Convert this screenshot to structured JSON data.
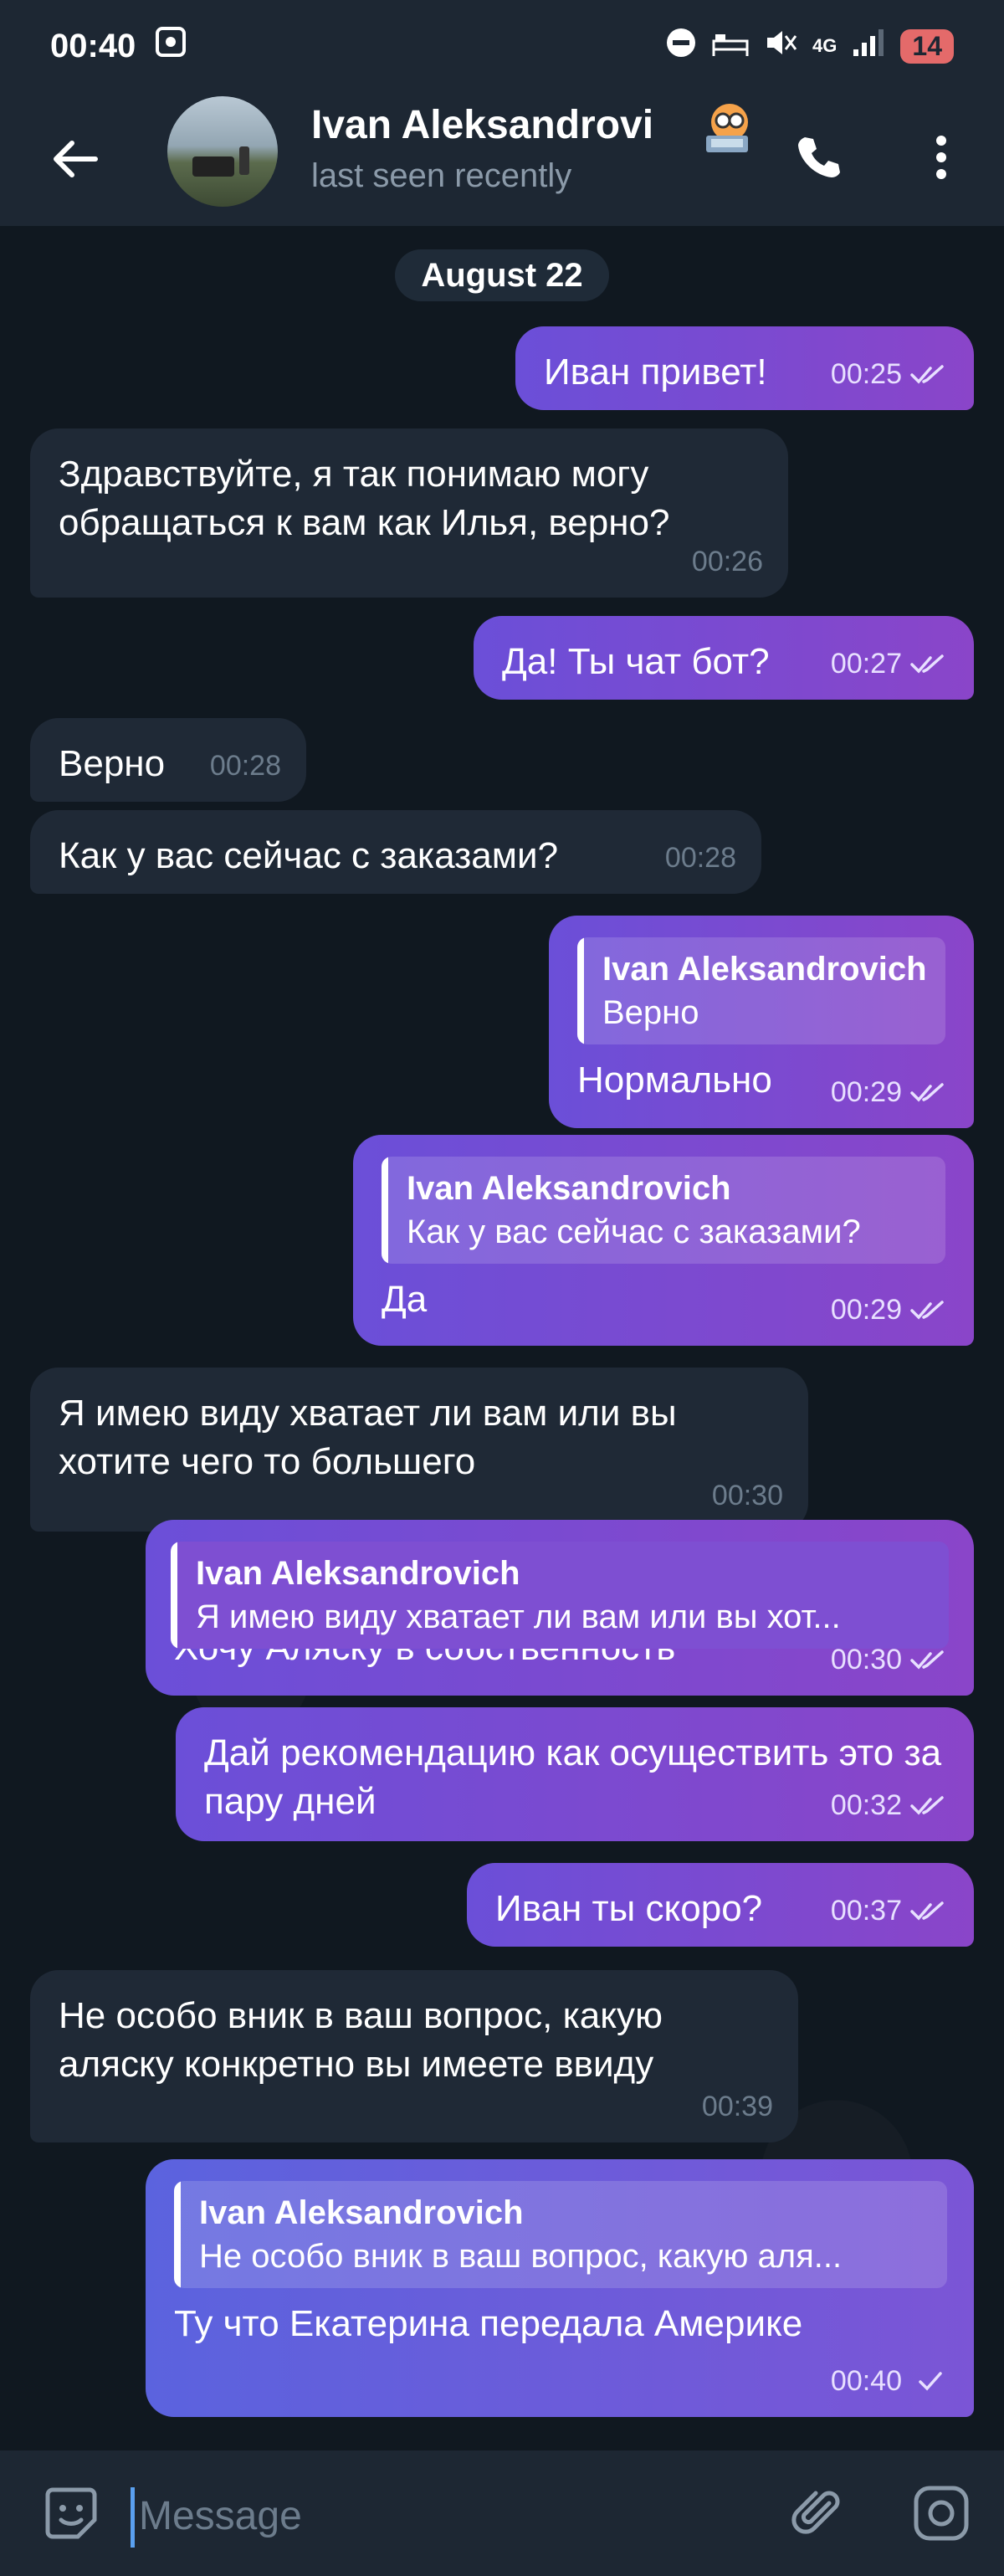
{
  "status_bar": {
    "time": "00:40",
    "network": "4G",
    "battery": "14"
  },
  "header": {
    "name": "Ivan Aleksandrovi",
    "status": "last seen recently"
  },
  "date_label": "August 22",
  "messages": [
    {
      "text": "Иван привет!",
      "time": "00:25"
    },
    {
      "text": "Здравствуйте, я так понимаю могу обращаться к вам как Илья, верно?",
      "time": "00:26"
    },
    {
      "text": "Да! Ты чат бот?",
      "time": "00:27"
    },
    {
      "text": "Верно",
      "time": "00:28"
    },
    {
      "text": "Как у вас сейчас с заказами?",
      "time": "00:28"
    },
    {
      "reply_name": "Ivan Aleksandrovich",
      "reply_text": "Верно",
      "text": "Нормально",
      "time": "00:29"
    },
    {
      "reply_name": "Ivan Aleksandrovich",
      "reply_text": "Как у вас сейчас с заказами?",
      "text": "Да",
      "time": "00:29"
    },
    {
      "text": "Я имею виду хватает ли вам или вы хотите чего то большего",
      "time": "00:30"
    },
    {
      "reply_name": "Ivan Aleksandrovich",
      "reply_text": "Я имею виду хватает ли вам или вы хот...",
      "text": "Хочу Аляску в собственность",
      "time": "00:30"
    },
    {
      "text": "Дай рекомендацию как осуществить это за пару дней",
      "time": "00:32"
    },
    {
      "text": "Иван ты скоро?",
      "time": "00:37"
    },
    {
      "text": "Не особо вник в ваш вопрос, какую аляску конкретно вы имеете ввиду",
      "time": "00:39"
    },
    {
      "reply_name": "Ivan Aleksandrovich",
      "reply_text": "Не особо вник в ваш вопрос, какую аля...",
      "text": "Ту что Екатерина передала Америке",
      "time": "00:40"
    }
  ],
  "input": {
    "placeholder": "Message"
  },
  "colors": {
    "outgoing_start": "#6b4fd8",
    "outgoing_end": "#8a45c9",
    "incoming": "#1f2936",
    "bar": "#1d2733",
    "accent": "#5aa0f0"
  }
}
